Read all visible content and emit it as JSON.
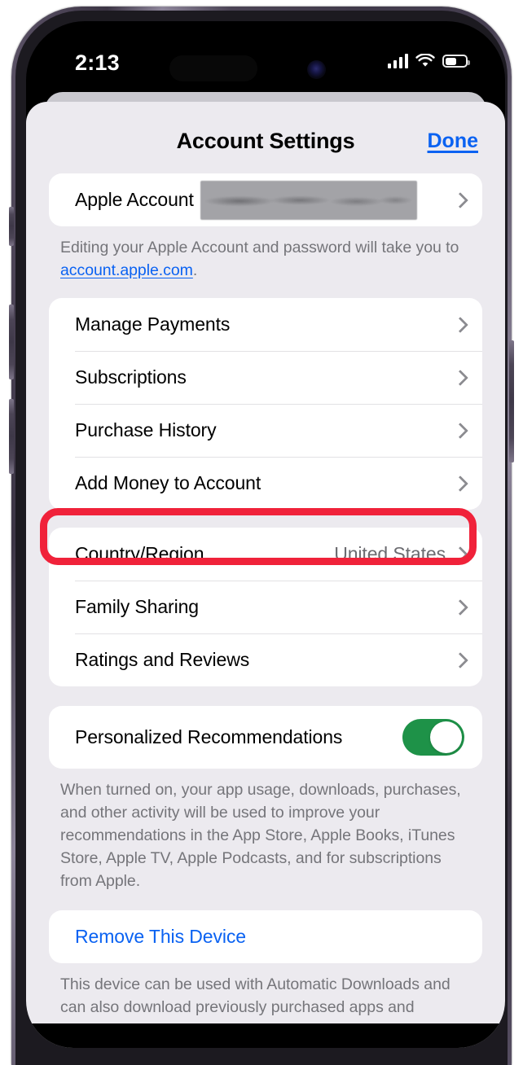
{
  "status_bar": {
    "time": "2:13",
    "cellular_icon": "cellular-bars-icon",
    "wifi_icon": "wifi-icon",
    "battery_icon": "battery-icon"
  },
  "header": {
    "title": "Account Settings",
    "done_label": "Done"
  },
  "account_group": {
    "rows": [
      {
        "label": "Apple Account",
        "value_redacted": true,
        "chevron": "chevron-right-icon"
      }
    ],
    "footnote_before": "Editing your Apple Account and password will take you to ",
    "footnote_link": "account.apple.com",
    "footnote_after": "."
  },
  "store_group": {
    "rows": [
      {
        "label": "Manage Payments",
        "chevron": "chevron-right-icon"
      },
      {
        "label": "Subscriptions",
        "chevron": "chevron-right-icon"
      },
      {
        "label": "Purchase History",
        "chevron": "chevron-right-icon"
      },
      {
        "label": "Add Money to Account",
        "chevron": "chevron-right-icon",
        "highlighted": true
      }
    ]
  },
  "region_group": {
    "rows": [
      {
        "label": "Country/Region",
        "value": "United States",
        "chevron": "chevron-right-icon"
      },
      {
        "label": "Family Sharing",
        "chevron": "chevron-right-icon"
      },
      {
        "label": "Ratings and Reviews",
        "chevron": "chevron-right-icon"
      }
    ]
  },
  "recommendations_group": {
    "label": "Personalized Recommendations",
    "toggle_state": "on",
    "footnote": "When turned on, your app usage, downloads, purchases, and other activity will be used to improve your recommendations in the App Store, Apple Books, iTunes Store, Apple TV, Apple Podcasts, and for subscriptions from Apple."
  },
  "device_group": {
    "label": "Remove This Device",
    "footnote": "This device can be used with Automatic Downloads and can also download previously purchased apps and"
  },
  "annotation": {
    "target": "Add Money to Account",
    "color": "#f0223a"
  },
  "colors": {
    "accent_blue": "#0a62f2",
    "toggle_green": "#1e9248",
    "sheet_background": "#eceaef",
    "row_background": "#ffffff",
    "secondary_text": "#75757a"
  }
}
